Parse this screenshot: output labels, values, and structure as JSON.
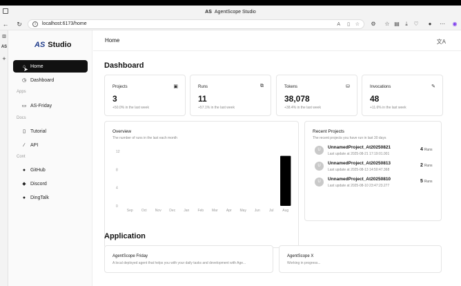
{
  "browser": {
    "window_title": "AgentScope Studio",
    "title_logo": "AS",
    "url": "localhost:6173/home"
  },
  "sidebar": {
    "brand_mark": "AS",
    "brand_name": "Studio",
    "items": [
      {
        "label": "Home",
        "icon": "home-icon",
        "active": true
      },
      {
        "label": "Dashboard",
        "icon": "dashboard-icon"
      }
    ],
    "sections": [
      {
        "label": "Apps",
        "items": [
          {
            "label": "AS-Friday",
            "icon": "chat-icon"
          }
        ]
      },
      {
        "label": "Docs",
        "items": [
          {
            "label": "Tutorial",
            "icon": "book-icon"
          },
          {
            "label": "API",
            "icon": "link-icon"
          }
        ]
      },
      {
        "label": "Cont",
        "items": [
          {
            "label": "GitHub",
            "icon": "github-icon"
          },
          {
            "label": "Discord",
            "icon": "discord-icon"
          },
          {
            "label": "DingTalk",
            "icon": "dingtalk-icon"
          }
        ]
      }
    ]
  },
  "header": {
    "title": "Home"
  },
  "dashboard": {
    "title": "Dashboard",
    "stats": [
      {
        "label": "Projects",
        "value": "3",
        "sub": "+50.0% in the last week",
        "icon": "folder-icon"
      },
      {
        "label": "Runs",
        "value": "11",
        "sub": "+57.1% in the last week",
        "icon": "layers-icon"
      },
      {
        "label": "Tokens",
        "value": "38,078",
        "sub": "+38.4% in the last week",
        "icon": "coins-icon"
      },
      {
        "label": "Invocations",
        "value": "48",
        "sub": "+11.6% in the last week",
        "icon": "wrench-icon"
      }
    ]
  },
  "overview": {
    "title": "Overview",
    "subtitle": "The number of runs in the last each month"
  },
  "chart_data": {
    "type": "bar",
    "title": "Overview",
    "categories": [
      "Sep",
      "Oct",
      "Nov",
      "Dec",
      "Jan",
      "Feb",
      "Mar",
      "Apr",
      "May",
      "Jun",
      "Jul",
      "Aug"
    ],
    "values": [
      0,
      0,
      0,
      0,
      0,
      0,
      0,
      0,
      0,
      0,
      0,
      11
    ],
    "yticks": [
      "0",
      "4",
      "8",
      "12"
    ],
    "ylim": [
      0,
      12
    ],
    "grid": false,
    "bar_color": "#000000"
  },
  "recent": {
    "title": "Recent Projects",
    "subtitle": "The recent projects you have run in last 30 days",
    "runs_unit": "Runs",
    "items": [
      {
        "name": "UnnamedProject_At20250821",
        "updated": "Last update at 2025-08-21 17:19:01.001",
        "runs": "4"
      },
      {
        "name": "UnnamedProject_At20250813",
        "updated": "Last update at 2025-08-13 14:50:47.368",
        "runs": "2"
      },
      {
        "name": "UnnamedProject_At20250810",
        "updated": "Last update at 2025-08-10 23:47:23.277",
        "runs": "5"
      }
    ]
  },
  "application": {
    "title": "Application",
    "cards": [
      {
        "title": "AgentScope Friday",
        "desc": "A local deployed agent that helps you with your daily tasks and development with Age..."
      },
      {
        "title": "AgentScope X",
        "desc": "Working in progress..."
      }
    ]
  },
  "colors": {
    "accent": "#111111",
    "muted": "#888888",
    "border": "#e5e5e5"
  }
}
